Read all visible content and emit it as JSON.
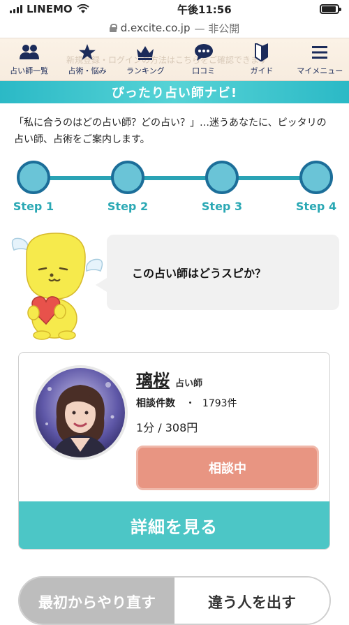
{
  "status_bar": {
    "carrier": "LINEMO",
    "time": "午後11:56",
    "battery_level": 0.9
  },
  "url_bar": {
    "domain": "d.excite.co.jp",
    "suffix": "— 非公開"
  },
  "nav": {
    "background_text": "新規登録・ログインの方法はこちらをご確認できます",
    "items": [
      {
        "label": "占い師一覧",
        "icon": "people-icon"
      },
      {
        "label": "占術・悩み",
        "icon": "star-icon"
      },
      {
        "label": "ランキング",
        "icon": "crown-icon"
      },
      {
        "label": "口コミ",
        "icon": "chat-bubble-icon"
      },
      {
        "label": "ガイド",
        "icon": "beginner-mark-icon"
      },
      {
        "label": "マイメニュー",
        "icon": "hamburger-menu-icon"
      }
    ]
  },
  "banner_title": "ぴったり占い師ナビ!",
  "intro_text": "「私に合うのはどの占い師？どの占い？」…迷うあなたに、ピッタリの占い師、占術をご案内します。",
  "steps": [
    "Step 1",
    "Step 2",
    "Step 3",
    "Step 4"
  ],
  "question": "この占い師はどうスピか？",
  "fortune_teller": {
    "name": "璃桜",
    "title": "占い師",
    "consult_label": "相談件数",
    "consult_separator": "・",
    "consult_count": "1793件",
    "price": "1分 / 308円",
    "status": "相談中",
    "detail_button": "詳細を見る"
  },
  "bottom_buttons": {
    "restart": "最初からやり直す",
    "other": "違う人を出す"
  },
  "colors": {
    "accent_teal": "#4cc6c6",
    "step_circle": "#6ac4d7",
    "step_border": "#1c6e99",
    "status_salmon": "#e89582",
    "nav_icon": "#1b2b5a"
  }
}
